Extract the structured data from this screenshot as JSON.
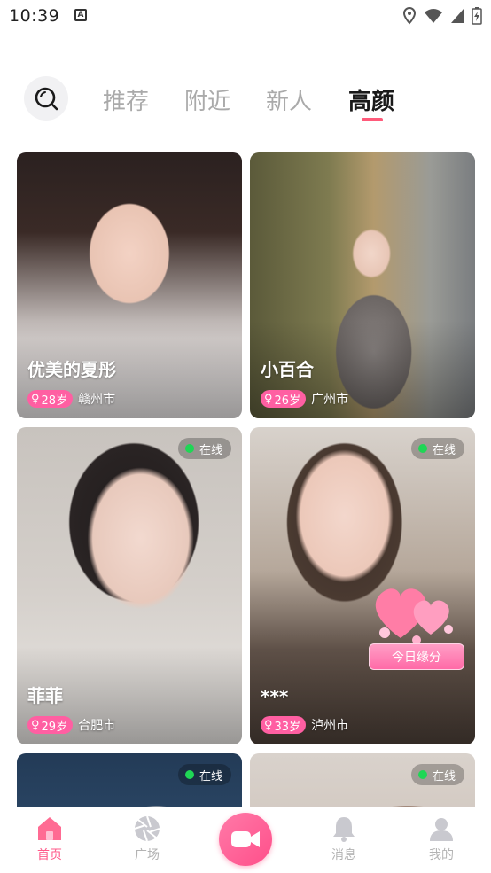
{
  "status_bar": {
    "time": "10:39"
  },
  "tabs": [
    {
      "label": "推荐",
      "active": false
    },
    {
      "label": "附近",
      "active": false
    },
    {
      "label": "新人",
      "active": false
    },
    {
      "label": "高颜",
      "active": true
    }
  ],
  "cards": [
    {
      "name": "优美的夏彤",
      "age": "28岁",
      "city": "赣州市",
      "online": false
    },
    {
      "name": "小百合",
      "age": "26岁",
      "city": "广州市",
      "online": false
    },
    {
      "name": "菲菲",
      "age": "29岁",
      "city": "合肥市",
      "online": true,
      "online_label": "在线"
    },
    {
      "name": "***",
      "age": "33岁",
      "city": "泸州市",
      "online": true,
      "online_label": "在线",
      "fate_button": "今日缘分"
    },
    {
      "online": true,
      "online_label": "在线"
    },
    {
      "online": true,
      "online_label": "在线"
    }
  ],
  "bottom_nav": [
    {
      "label": "首页",
      "icon": "home-icon",
      "active": true
    },
    {
      "label": "广场",
      "icon": "aperture-icon",
      "active": false
    },
    {
      "label": "",
      "icon": "video-camera-icon",
      "active": false
    },
    {
      "label": "消息",
      "icon": "bell-icon",
      "active": false
    },
    {
      "label": "我的",
      "icon": "person-icon",
      "active": false
    }
  ],
  "colors": {
    "accent": "#ff5a8a",
    "online": "#1fd655",
    "badge": "#ff5fa2"
  }
}
